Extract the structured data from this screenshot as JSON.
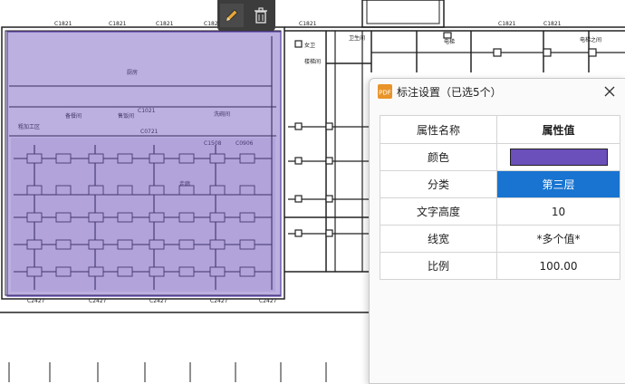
{
  "canvas": {
    "labels": {
      "c1821": "C1821",
      "c2427": "C2427",
      "c1508": "C1508",
      "c0721": "C0721",
      "c1021": "C1021",
      "c0906": "C0906",
      "kitchen": "厨房",
      "pantry": "售饭间",
      "cold_room": "粗加工区",
      "prep": "备餐间",
      "dish": "洗碗间",
      "corridor": "走廊",
      "stair": "楼梯间",
      "sanitary": "卫生间",
      "wc": "女卫",
      "elevator": "电梯",
      "right_room": "电梯之间",
      "selection_color": "#6b4fbb"
    }
  },
  "toolstrip": {
    "edit_icon": "pencil-icon",
    "delete_icon": "trash-icon"
  },
  "dialog": {
    "title": "标注设置（已选5个）",
    "app_icon": "pdf-app-icon",
    "close_icon": "close-icon",
    "header": {
      "name": "属性名称",
      "value": "属性值"
    },
    "rows": [
      {
        "name": "颜色",
        "value": "",
        "color": "#6b4fbb"
      },
      {
        "name": "分类",
        "value": "第三层",
        "selected": true
      },
      {
        "name": "文字高度",
        "value": "10"
      },
      {
        "name": "线宽",
        "value": "*多个值*"
      },
      {
        "name": "比例",
        "value": "100.00"
      }
    ]
  }
}
